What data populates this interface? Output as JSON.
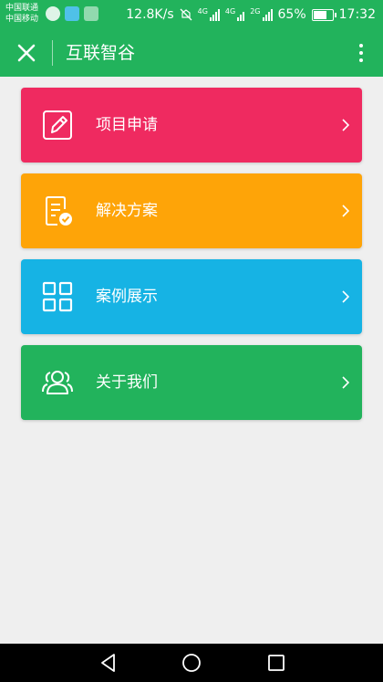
{
  "status_bar": {
    "carrier_1": "中国联通",
    "carrier_2": "中国移动",
    "net_speed": "12.8K/s",
    "net_4g_a": "4G",
    "net_4g_b": "4G",
    "net_2g": "2G",
    "battery": "65%",
    "battery_level": 0.65,
    "time": "17:32"
  },
  "navbar": {
    "title": "互联智谷"
  },
  "menu": [
    {
      "label": "项目申请",
      "icon": "edit-icon",
      "color": "#ef2a60"
    },
    {
      "label": "解决方案",
      "icon": "document-check-icon",
      "color": "#fea408"
    },
    {
      "label": "案例展示",
      "icon": "grid-icon",
      "color": "#16b3e4"
    },
    {
      "label": "关于我们",
      "icon": "users-icon",
      "color": "#22b35c"
    }
  ],
  "colors": {
    "primary": "#22b35c",
    "background": "#efefef"
  }
}
